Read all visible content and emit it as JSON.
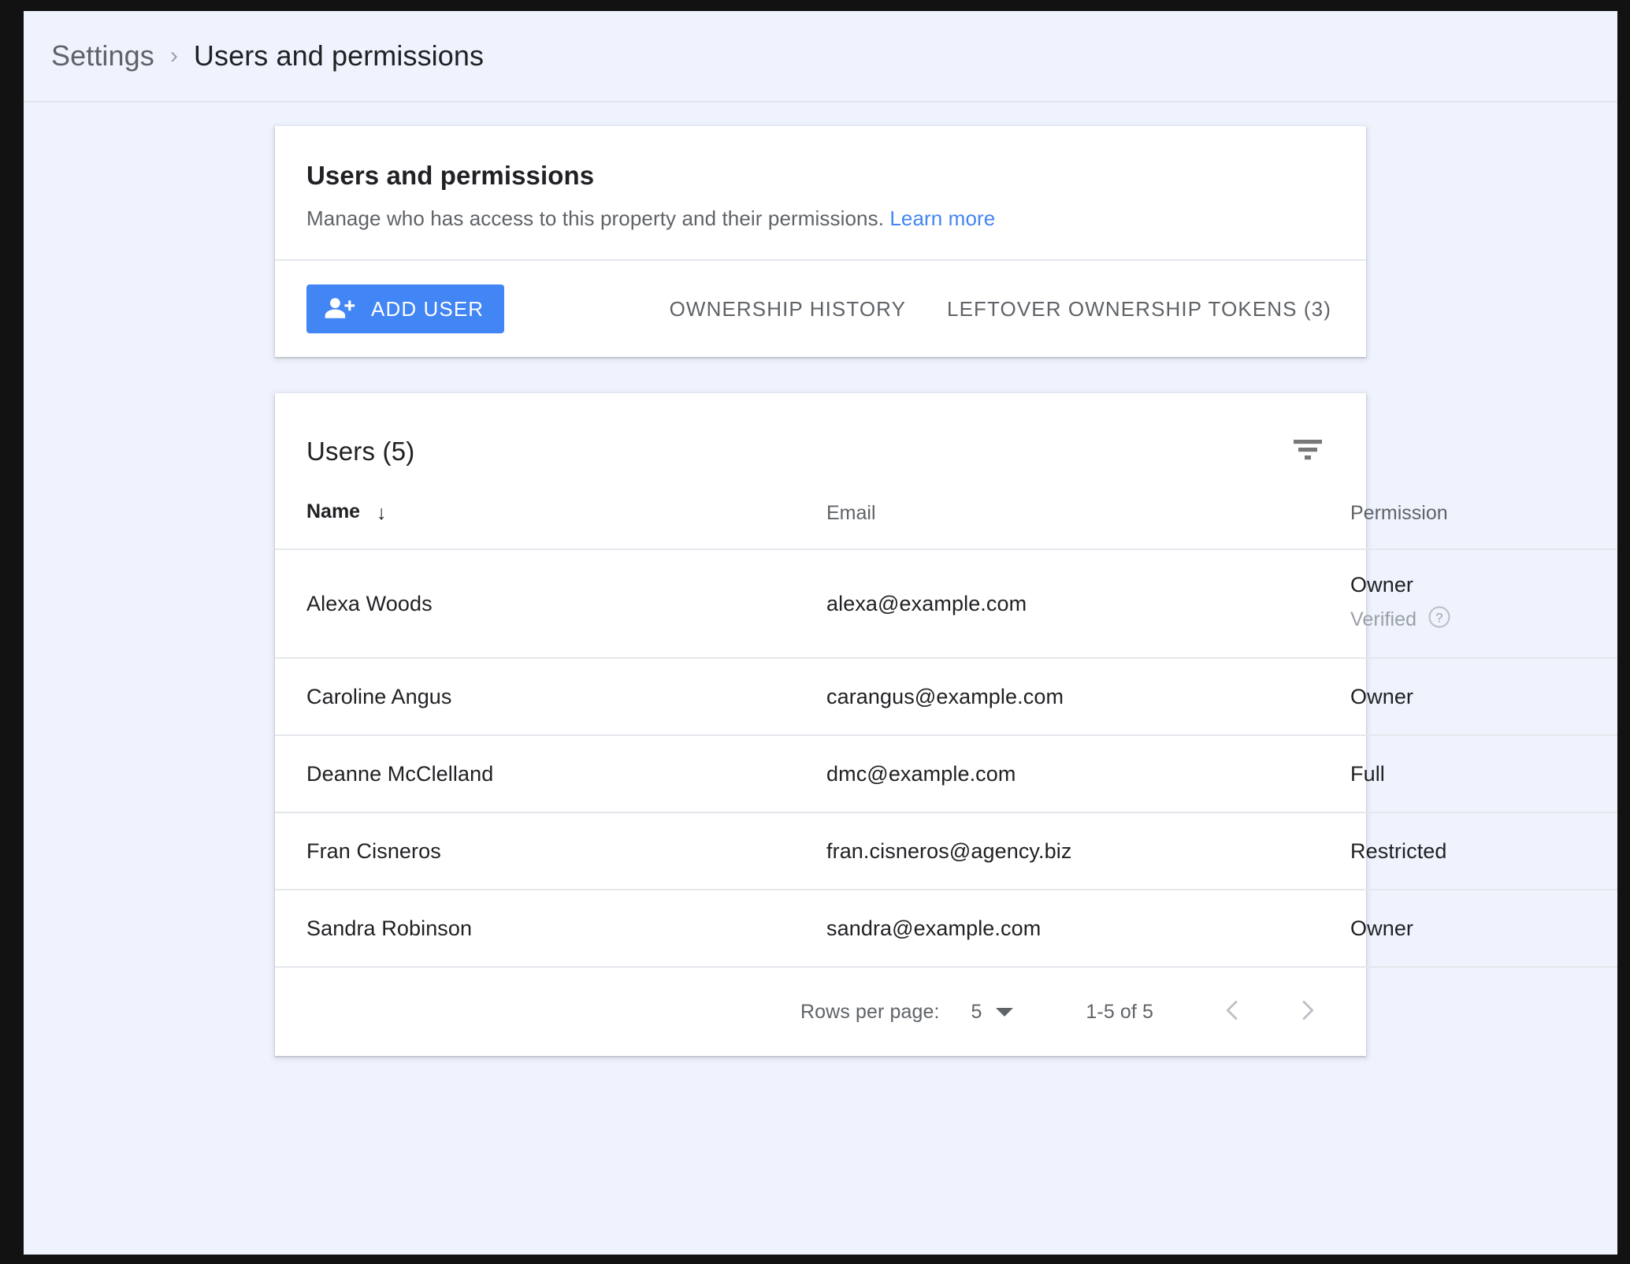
{
  "breadcrumb": {
    "parent": "Settings",
    "separator": "›",
    "current": "Users and permissions"
  },
  "intro_card": {
    "title": "Users and permissions",
    "description": "Manage who has access to this property and their permissions.",
    "learn_more": "Learn more",
    "add_user_label": "ADD USER",
    "links": [
      {
        "label": "OWNERSHIP HISTORY"
      },
      {
        "label": "LEFTOVER OWNERSHIP TOKENS (3)"
      }
    ]
  },
  "users_card": {
    "title": "Users (5)",
    "columns": {
      "name": "Name",
      "email": "Email",
      "permission": "Permission"
    },
    "sort_arrow": "↓",
    "rows": [
      {
        "name": "Alexa Woods",
        "email": "alexa@example.com",
        "permission": "Owner",
        "status": "Verified"
      },
      {
        "name": "Caroline Angus",
        "email": "carangus@example.com",
        "permission": "Owner",
        "status": ""
      },
      {
        "name": "Deanne McClelland",
        "email": "dmc@example.com",
        "permission": "Full",
        "status": ""
      },
      {
        "name": "Fran Cisneros",
        "email": "fran.cisneros@agency.biz",
        "permission": "Restricted",
        "status": ""
      },
      {
        "name": "Sandra Robinson",
        "email": "sandra@example.com",
        "permission": "Owner",
        "status": ""
      }
    ],
    "footer": {
      "rows_per_page_label": "Rows per page:",
      "rows_per_page_value": "5",
      "range": "1-5 of 5"
    }
  },
  "colors": {
    "accent": "#4285f4",
    "page_background": "#eff3fd",
    "card_background": "#ffffff",
    "text_primary": "#202124",
    "text_secondary": "#5f6368",
    "text_muted": "#9aa0a6",
    "divider": "#e4e7ec"
  }
}
